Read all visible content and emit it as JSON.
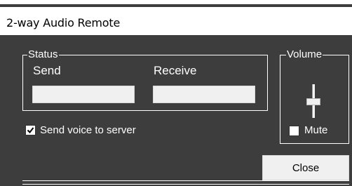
{
  "window": {
    "title": "2-way Audio Remote"
  },
  "status_group": {
    "legend": "Status",
    "send_label": "Send",
    "receive_label": "Receive"
  },
  "send_voice": {
    "label": "Send voice to server",
    "checked": true
  },
  "volume_group": {
    "legend": "Volume",
    "mute_label": "Mute",
    "mute_checked": false
  },
  "actions": {
    "close_label": "Close"
  },
  "colors": {
    "panel_bg": "#3d3d3d",
    "frame_line": "#ffffff",
    "button_bg": "#f0f0f0"
  }
}
